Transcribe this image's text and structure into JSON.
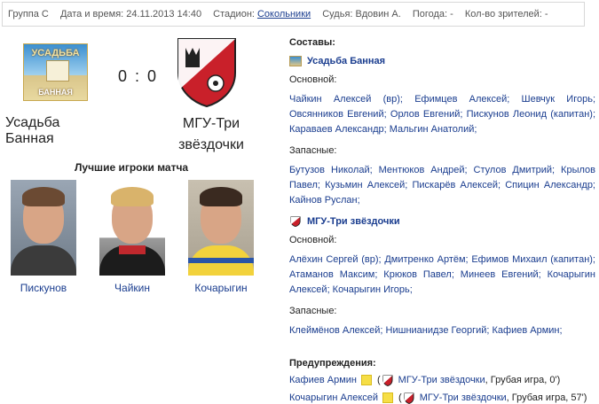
{
  "info": {
    "group": "Группа С",
    "datetime": "Дата и время: 24.11.2013 14:40",
    "stadium_prefix": "Стадион:",
    "stadium_link": "Сокольники",
    "referee": "Судья: Вдовин А.",
    "weather": "Погода: -",
    "spectators": "Кол-во зрителей: -"
  },
  "logos": {
    "team1_top": "УСАДЬБА",
    "team1_bottom": "БАННАЯ"
  },
  "score": "0 : 0",
  "team1_name": "Усадьба Банная",
  "team2_name": "МГУ-Три звёздочки",
  "best_players": {
    "title": "Лучшие игроки матча",
    "players": [
      "Пискунов",
      "Чайкин",
      "Кочарыгин"
    ]
  },
  "lineups": {
    "title": "Составы:",
    "team1": {
      "name": "Усадьба Банная",
      "main_label": "Основной:",
      "main": "Чайкин Алексей (вр); Ефимцев Алексей; Шевчук Игорь; Овсянников Евгений; Орлов Евгений; Пискунов Леонид (капитан); Караваев Александр; Мальгин Анатолий;",
      "subs_label": "Запасные:",
      "subs": "Бутузов Николай; Ментюков Андрей; Стулов Дмитрий; Крылов Павел; Кузьмин Алексей; Пискарёв Алексей; Спицин Александр; Кайнов Руслан;"
    },
    "team2": {
      "name": "МГУ-Три звёздочки",
      "main_label": "Основной:",
      "main": "Алёхин Сергей (вр); Дмитренко Артём; Ефимов Михаил (капитан); Атаманов Максим; Крюков Павел; Минеев Евгений; Кочарыгин Алексей; Кочарыгин Игорь;",
      "subs_label": "Запасные:",
      "subs": "Клеймёнов Алексей; Нишнианидзе Георгий; Кафиев Армин;"
    }
  },
  "warnings": {
    "title": "Предупреждения:",
    "items": [
      {
        "player": "Кафиев Армин",
        "team": "МГУ-Три звёздочки",
        "detail": ", Грубая игра, 0')"
      },
      {
        "player": "Кочарыгин Алексей",
        "team": "МГУ-Три звёздочки",
        "detail": ", Грубая игра, 57')"
      }
    ]
  }
}
